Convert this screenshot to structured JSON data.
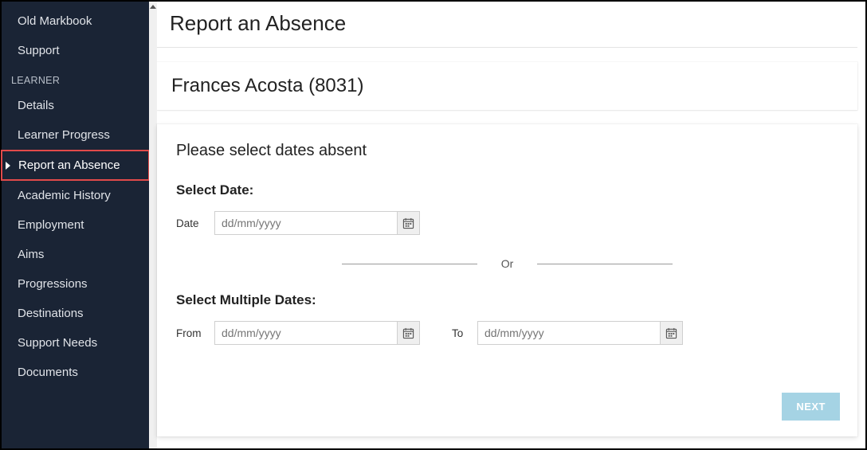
{
  "sidebar": {
    "top_items": [
      {
        "label": "Old Markbook"
      },
      {
        "label": "Support"
      }
    ],
    "section_header": "LEARNER",
    "learner_items": [
      {
        "label": "Details"
      },
      {
        "label": "Learner Progress"
      },
      {
        "label": "Report an Absence",
        "active": true
      },
      {
        "label": "Academic History"
      },
      {
        "label": "Employment"
      },
      {
        "label": "Aims"
      },
      {
        "label": "Progressions"
      },
      {
        "label": "Destinations"
      },
      {
        "label": "Support Needs"
      },
      {
        "label": "Documents"
      }
    ]
  },
  "page": {
    "title": "Report an Absence",
    "learner_display": "Frances Acosta (8031)"
  },
  "form": {
    "instruction": "Please select dates absent",
    "single": {
      "heading": "Select Date:",
      "label": "Date",
      "placeholder": "dd/mm/yyyy"
    },
    "divider_label": "Or",
    "range": {
      "heading": "Select Multiple Dates:",
      "from_label": "From",
      "from_placeholder": "dd/mm/yyyy",
      "to_label": "To",
      "to_placeholder": "dd/mm/yyyy"
    },
    "next_label": "NEXT"
  }
}
